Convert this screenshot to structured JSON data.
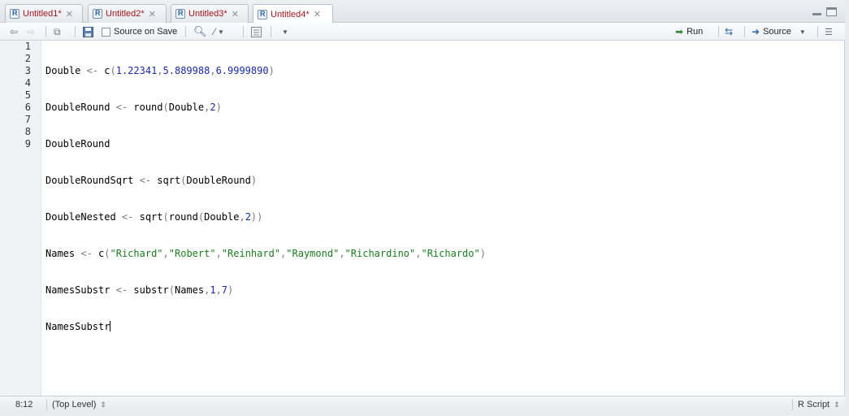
{
  "tabs": [
    {
      "label": "Untitled1*",
      "active": false
    },
    {
      "label": "Untitled2*",
      "active": false
    },
    {
      "label": "Untitled3*",
      "active": false
    },
    {
      "label": "Untitled4*",
      "active": true
    }
  ],
  "toolbar": {
    "source_on_save_label": "Source on Save",
    "run_label": "Run",
    "source_label": "Source"
  },
  "editor": {
    "line_numbers": [
      "1",
      "2",
      "3",
      "4",
      "5",
      "6",
      "7",
      "8",
      "9"
    ],
    "lines": [
      "Double <- c(1.22341,5.889988,6.9999890)",
      "DoubleRound <- round(Double,2)",
      "DoubleRound",
      "DoubleRoundSqrt <- sqrt(DoubleRound)",
      "DoubleNested <- sqrt(round(Double,2))",
      "Names <- c(\"Richard\",\"Robert\",\"Reinhard\",\"Raymond\",\"Richardino\",\"Richardo\")",
      "NamesSubstr <- substr(Names,1,7)",
      "NamesSubstr",
      ""
    ]
  },
  "status": {
    "cursor_position": "8:12",
    "scope": "(Top Level)",
    "file_type": "R Script"
  },
  "colors": {
    "tab_text": "#a0161b",
    "number": "#1a2aa0",
    "string": "#1c7d20",
    "operator": "#7a7a7a"
  }
}
